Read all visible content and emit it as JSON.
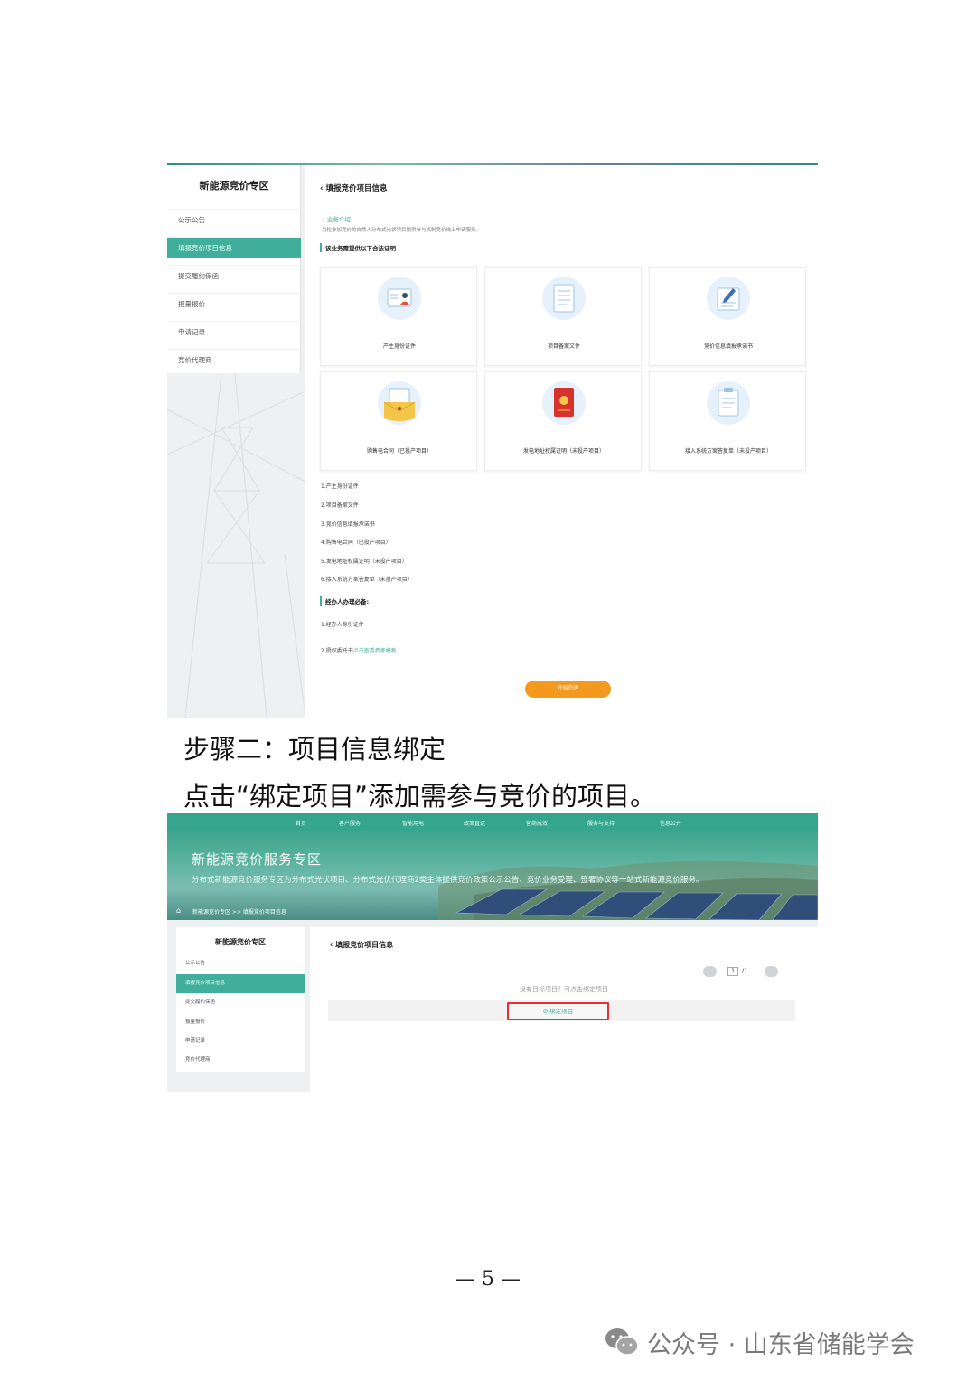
{
  "shot1": {
    "sidebar": {
      "title": "新能源竞价专区",
      "items": [
        "公示公告",
        "填报竞价项目信息",
        "提交履约保函",
        "报量报价",
        "申请记录",
        "竞价代理商"
      ]
    },
    "main": {
      "title": "填报竞价项目信息",
      "intro_label": "◦ 业务介绍",
      "intro_text": "为粒参加竞价的自然人分布式光伏项目提供参与机制竞价线上申请服务。",
      "need_title": "该业务需提供以下合法证明",
      "cards": [
        {
          "label": "产主身份证件",
          "icon": "id-card-icon"
        },
        {
          "label": "项目备案文件",
          "icon": "document-icon"
        },
        {
          "label": "竞价信息填报承诺书",
          "icon": "pledge-edit-icon"
        },
        {
          "label": "购售电合同（已投产项目）",
          "icon": "envelope-contract-icon"
        },
        {
          "label": "发电地址权属证明（未投产项目）",
          "icon": "property-certificate-icon"
        },
        {
          "label": "接入系统方案答复单（未投产项目）",
          "icon": "clipboard-icon"
        }
      ],
      "requirements": [
        "1.产主身份证件",
        "2.项目备案文件",
        "3.竞价信息填报承诺书",
        "4.购售电合同（已投产项目）",
        "5.发电地址权属证明（未投产项目）",
        "6.接入系统方案答复单（未投产项目）"
      ],
      "agent_title": "经办人办理必备:",
      "agent_items": {
        "item1": "1.经办人身份证件",
        "item2_prefix": "2.授权委托书",
        "item2_link": "点击查看参考模板"
      },
      "start_button": "开始办理"
    }
  },
  "captions": {
    "step_title": "步骤二：项目信息绑定",
    "step_desc": "点击“绑定项目”添加需参与竞价的项目。"
  },
  "shot2": {
    "nav": [
      "首页",
      "客户服务",
      "智能用电",
      "政策直达",
      "营商成效",
      "服务与支持",
      "信息公开"
    ],
    "banner": {
      "title": "新能源竞价服务专区",
      "subtitle": "分布式新能源竞价服务专区为分布式光伏项目、分布式光伏代理商2类主体提供竞价政策公示公告、竞价业务受理、签署协议等一站式新能源竞价服务。"
    },
    "breadcrumb": "新能源竞价专区  >>  填报竞价项目信息",
    "sidebar": {
      "title": "新能源竞价专区",
      "items": [
        "公示公告",
        "填报竞价项目信息",
        "提交履约保函",
        "报量报价",
        "申请记录",
        "竞价代理商"
      ]
    },
    "main": {
      "title": "填报竞价项目信息",
      "pager_current": "1",
      "pager_total": "/1",
      "empty_text": "没有目标项目？可点击绑定项目",
      "bind_button": "绑定项目"
    }
  },
  "footer": {
    "page_number": "— 5 —",
    "watermark": "公众号 · 山东省储能学会"
  },
  "colors": {
    "accent": "#3fae9b",
    "orange": "#f39a1e",
    "highlight_red": "#e03333"
  }
}
